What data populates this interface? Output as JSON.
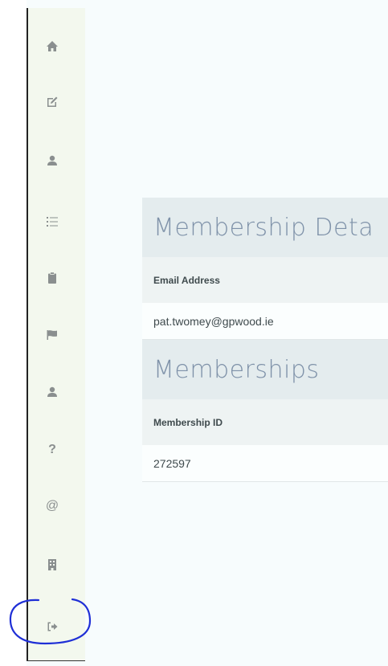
{
  "sidebar": {
    "items": [
      {
        "icon": "home-icon"
      },
      {
        "icon": "edit-icon"
      },
      {
        "icon": "user-icon"
      },
      {
        "icon": "list-icon"
      },
      {
        "icon": "clipboard-icon"
      },
      {
        "icon": "flag-icon"
      },
      {
        "icon": "user-icon"
      },
      {
        "icon": "question-icon",
        "glyph": "?"
      },
      {
        "icon": "at-icon",
        "glyph": "@"
      },
      {
        "icon": "building-icon"
      },
      {
        "icon": "sign-out-icon"
      }
    ]
  },
  "membership_details": {
    "title": "Membership Deta",
    "column_header": "Email Address",
    "value": "pat.twomey@gpwood.ie"
  },
  "memberships": {
    "title": "Memberships",
    "column_header": "Membership ID",
    "value": "272597"
  },
  "colors": {
    "sidebar_bg": "#f3f8ee",
    "icon": "#8a8f8f",
    "header_text": "#7f92a9",
    "annotation": "#1f2fd6"
  }
}
